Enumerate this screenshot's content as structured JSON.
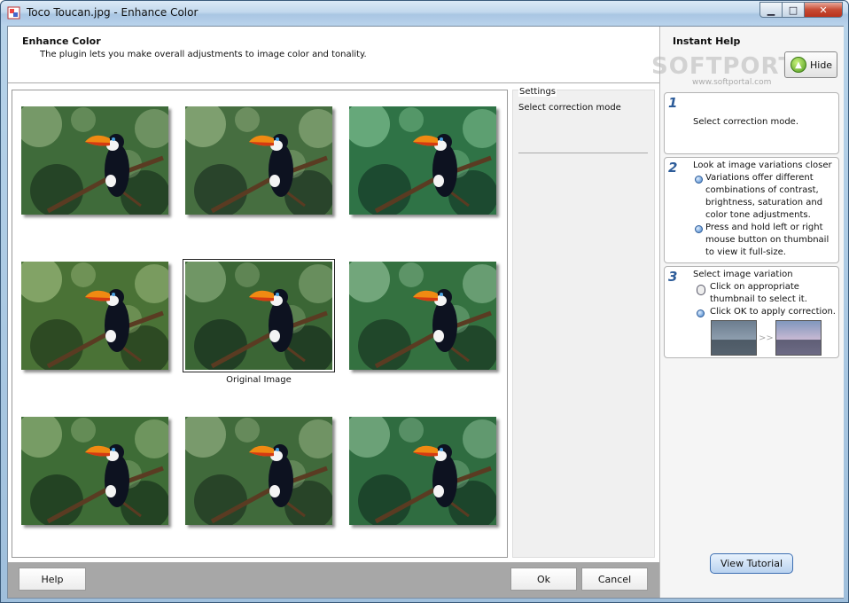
{
  "window": {
    "title": "Toco Toucan.jpg - Enhance Color",
    "controls": {
      "minimize_icon": "minimize-icon",
      "maximize_icon": "maximize-icon",
      "close_icon": "close-icon"
    }
  },
  "header": {
    "title": "Enhance Color",
    "description": "The plugin lets you make overall adjustments to image color and tonality."
  },
  "settings": {
    "title": "Settings",
    "mode_text": "Select correction mode"
  },
  "thumbnails": {
    "original_label": "Original Image",
    "items": [
      {
        "name": "variation-1"
      },
      {
        "name": "variation-2"
      },
      {
        "name": "variation-3"
      },
      {
        "name": "variation-4"
      },
      {
        "name": "original"
      },
      {
        "name": "variation-6"
      },
      {
        "name": "variation-7"
      },
      {
        "name": "variation-8"
      },
      {
        "name": "variation-9"
      }
    ]
  },
  "buttons": {
    "help": "Help",
    "ok": "Ok",
    "cancel": "Cancel"
  },
  "instant_help": {
    "title": "Instant Help",
    "hide_label": "Hide",
    "watermark": "SOFTPORTAL",
    "watermark_url": "www.softportal.com",
    "steps": [
      {
        "num": "1",
        "text": "Select correction mode."
      },
      {
        "num": "2",
        "heading": "Look at image variations closer",
        "bullets": [
          "Variations offer different combinations of contrast, brightness, saturation and color tone adjustments.",
          "Press and hold left or right mouse button on thumbnail to view it full-size."
        ]
      },
      {
        "num": "3",
        "heading": "Select image variation",
        "bullets": [
          "Click on appropriate thumbnail to select it.",
          "Click OK to apply correction."
        ]
      }
    ],
    "tutorial_label": "View Tutorial"
  }
}
